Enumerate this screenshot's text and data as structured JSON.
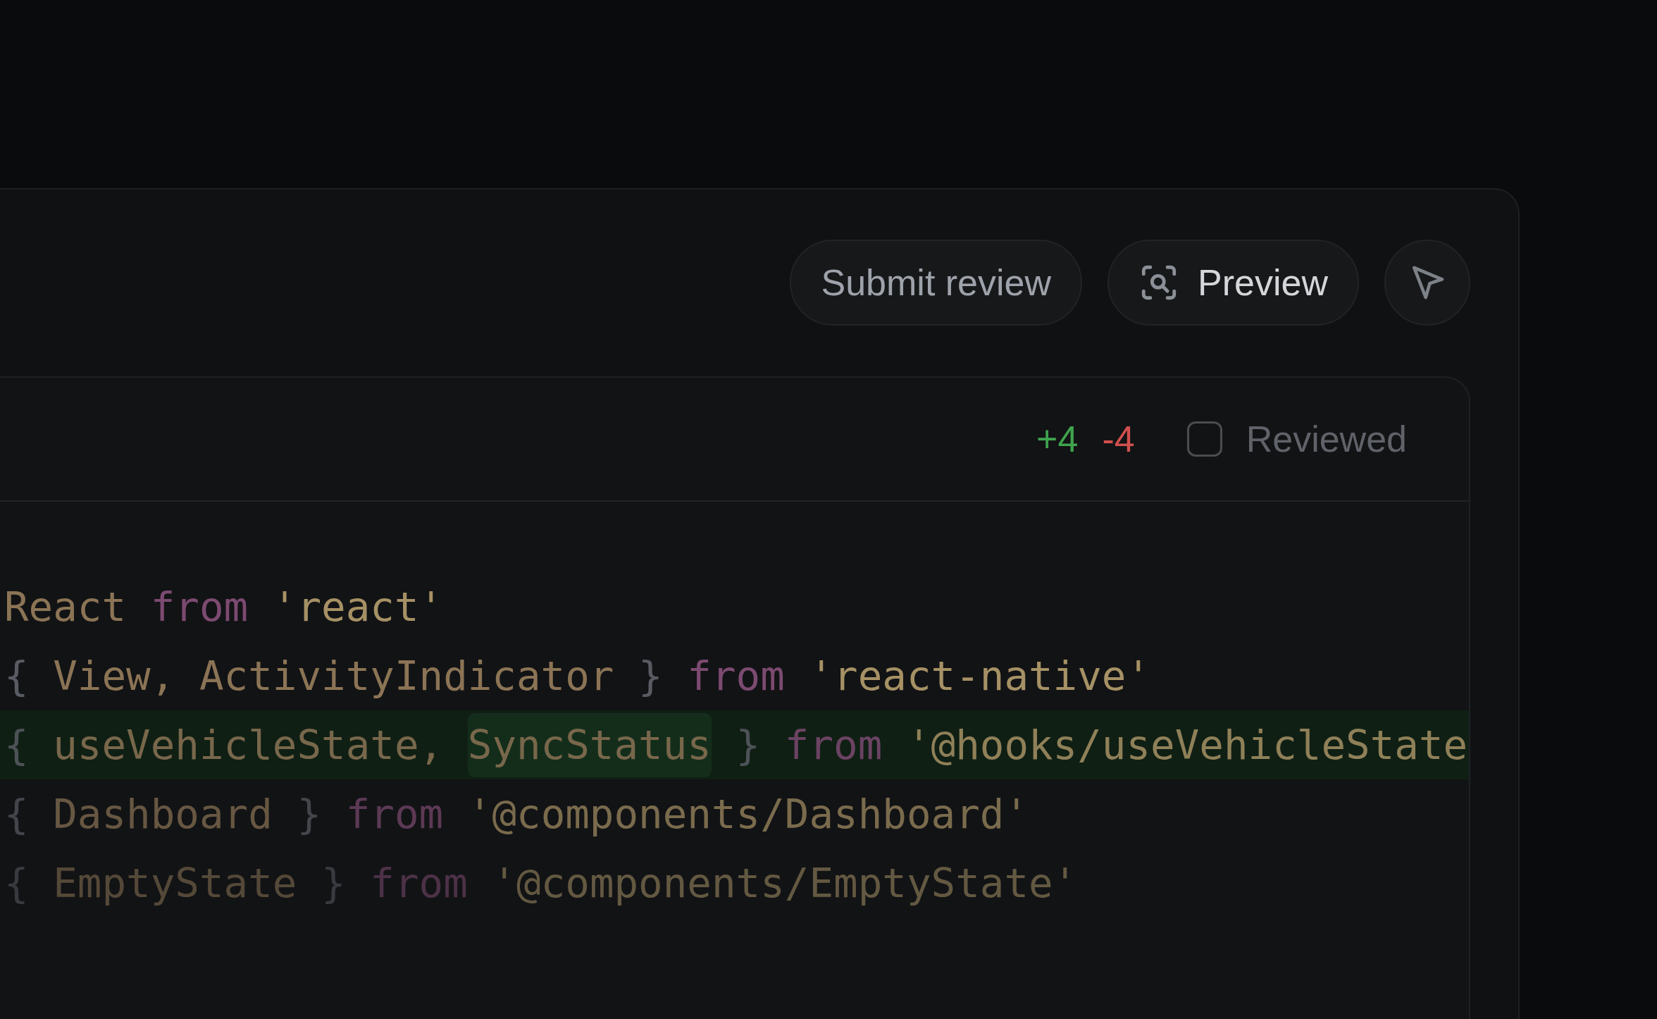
{
  "toolbar": {
    "buttons": [
      {
        "kind": "text",
        "label": "Submit review"
      },
      {
        "kind": "icon-text",
        "label": "Preview"
      },
      {
        "kind": "icon"
      }
    ]
  },
  "file_header": {
    "additions": "+4",
    "deletions": "-4",
    "reviewed": {
      "label": "Reviewed",
      "checked": false
    }
  },
  "code_lines": [
    {
      "added": false,
      "tokens": [
        {
          "kind": "ident",
          "text": "React "
        },
        {
          "kind": "keyword",
          "text": "from "
        },
        {
          "kind": "string",
          "text": "'react'"
        }
      ]
    },
    {
      "added": false,
      "tokens": [
        {
          "kind": "punct",
          "text": "{ "
        },
        {
          "kind": "ident",
          "text": "View, ActivityIndicator "
        },
        {
          "kind": "punct",
          "text": "} "
        },
        {
          "kind": "keyword",
          "text": "from "
        },
        {
          "kind": "string",
          "text": "'react-native'"
        }
      ]
    },
    {
      "added": true,
      "tokens": [
        {
          "kind": "punct",
          "text": "{ "
        },
        {
          "kind": "ident",
          "text": "useVehicleState, "
        },
        {
          "kind": "ident",
          "text": "SyncStatus",
          "highlight": true
        },
        {
          "kind": "punct",
          "text": " } "
        },
        {
          "kind": "keyword",
          "text": "from "
        },
        {
          "kind": "string",
          "text": "'@hooks/useVehicleState"
        }
      ]
    },
    {
      "added": false,
      "tokens": [
        {
          "kind": "punct",
          "text": "{ "
        },
        {
          "kind": "ident",
          "text": "Dashboard "
        },
        {
          "kind": "punct",
          "text": "} "
        },
        {
          "kind": "keyword",
          "text": "from "
        },
        {
          "kind": "string",
          "text": "'@components/Dashboard'"
        }
      ]
    },
    {
      "added": false,
      "tokens": [
        {
          "kind": "punct",
          "text": "{ "
        },
        {
          "kind": "ident",
          "text": "EmptyState "
        },
        {
          "kind": "punct",
          "text": "} "
        },
        {
          "kind": "keyword",
          "text": "from "
        },
        {
          "kind": "string",
          "text": "'@components/EmptyState'"
        }
      ]
    }
  ]
}
